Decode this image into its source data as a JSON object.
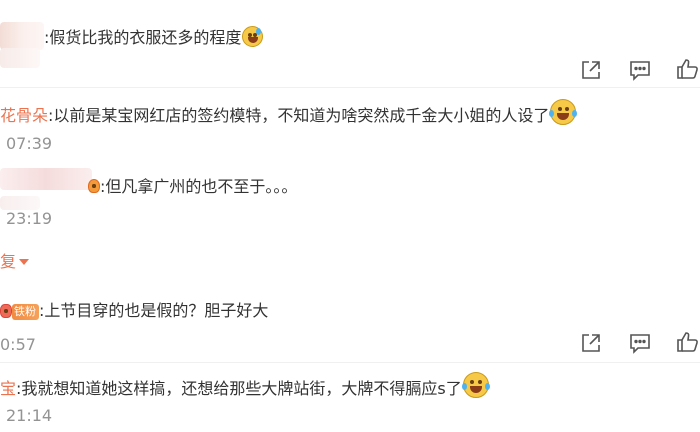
{
  "comments": [
    {
      "prefix": ":",
      "text": "假货比我的衣服还多的程度",
      "emoji": "grinning-sweat-emoji"
    },
    {
      "author": "花骨朵",
      "text": ":以前是某宝网红店的签约模特，不知道为啥突然成千金大小姐的人设了",
      "emoji": "tears-of-joy-emoji",
      "time": "07:39"
    },
    {
      "text": ":但凡拿广州的也不至于。。。",
      "time": "23:19",
      "expand_label": "复"
    },
    {
      "badge": "铁粉",
      "text": ":上节目穿的也是假的？胆子好大",
      "time": "0:57"
    },
    {
      "author": "宝",
      "text": ":我就想知道她这样搞，还想给那些大牌站街，大牌不得膈应s了",
      "emoji": "tears-of-joy-emoji",
      "time": "21:14"
    }
  ],
  "colors": {
    "author": "#eb7350",
    "text": "#333333",
    "time": "#939393",
    "icon": "#555555"
  },
  "icons": [
    "share-icon",
    "comment-icon",
    "like-icon"
  ]
}
